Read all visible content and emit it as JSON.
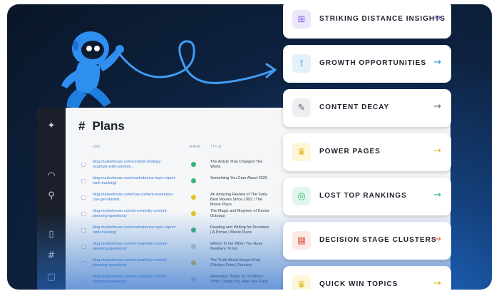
{
  "app": {
    "title": "Plans",
    "columns": {
      "url": "URL",
      "rank": "RANK",
      "title": "TITLE"
    },
    "rows": [
      {
        "url": "blog.marketmuse.com/content-strategy-example-with-content-...",
        "title": "The Article That Changed The World",
        "status_color": "#3bb273"
      },
      {
        "url": "blog.marketmuse.com/marketmuse-topic-report-rank-tracking/",
        "title": "Something You Care About 2020",
        "status_color": "#3bb273"
      },
      {
        "url": "blog.marketmuse.com/how-content-marketers-can-get-started...",
        "title": "An Amazing Review of The Forty Best Movies Since 1992 | The Movie Place",
        "status_color": "#e6c229"
      },
      {
        "url": "blog.marketmuse.com/ai-creativity-content-planning-questions/",
        "title": "The Magic and Mayhem of Doctor Octopus",
        "status_color": "#e6c229"
      },
      {
        "url": "blog.marketmuse.com/marketmuse-topic-report-rank-tracking/",
        "title": "Reading and Writing for Dummies | A Primer | Movie Place",
        "status_color": "#3bb273"
      },
      {
        "url": "blog.marketmuse.com/ai-creativity-content-planning-questions/",
        "title": "Where To Go When You Have Nowhere To Go",
        "status_color": "#c8ccd2"
      },
      {
        "url": "blog.marketmuse.com/ai-creativity-content-planning-questions/",
        "title": "The Truth About Burger King Chicken Fries | Sunnies",
        "status_color": "#e6c229"
      },
      {
        "url": "blog.marketmuse.com/ai-creativity-content-planning-questions/",
        "title": "Awesome Things To Do When Other Things You Want Are Gone",
        "status_color": "#c8ccd2"
      }
    ]
  },
  "cards": [
    {
      "label": "STRIKING DISTANCE INSIGHTS",
      "icon": "plus-square-icon",
      "glyph": "⊞",
      "icon_bg": "#ece6fb",
      "icon_color": "#7b5ce0",
      "arrow_color": "#7b5ce0"
    },
    {
      "label": "GROWTH OPPORTUNITIES",
      "icon": "share-nodes-icon",
      "glyph": "⟟",
      "icon_bg": "#e3f1fb",
      "icon_color": "#2f8fd8",
      "arrow_color": "#2f8fd8"
    },
    {
      "label": "CONTENT DECAY",
      "icon": "edit-square-icon",
      "glyph": "✎",
      "icon_bg": "#eceef1",
      "icon_color": "#5d6470",
      "arrow_color": "#5d6470"
    },
    {
      "label": "POWER PAGES",
      "icon": "trophy-icon",
      "glyph": "♛",
      "icon_bg": "#fdf6d8",
      "icon_color": "#e0b91a",
      "arrow_color": "#e0b91a"
    },
    {
      "label": "LOST TOP RANKINGS",
      "icon": "compass-icon",
      "glyph": "◎",
      "icon_bg": "#e2f7ec",
      "icon_color": "#2fb877",
      "arrow_color": "#2fb877"
    },
    {
      "label": "DECISION STAGE CLUSTERS",
      "icon": "grid-icon",
      "glyph": "▦",
      "icon_bg": "#fde8e4",
      "icon_color": "#e06a4f",
      "arrow_color": "#e06a4f"
    },
    {
      "label": "QUICK WIN TOPICS",
      "icon": "trophy-icon",
      "glyph": "♛",
      "icon_bg": "#fdf6d8",
      "icon_color": "#e0b91a",
      "arrow_color": "#e0b91a"
    }
  ],
  "arrow_glyph": "→"
}
